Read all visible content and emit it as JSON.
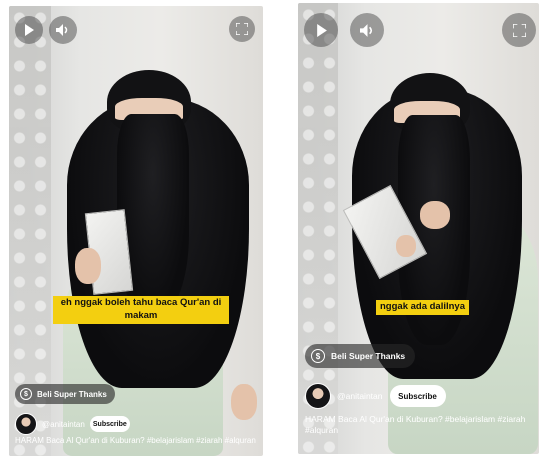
{
  "left_short": {
    "caption": "eh nggak boleh tahu baca Qur'an di makam",
    "thanks_label": "Beli Super Thanks",
    "channel": "@anitaintan",
    "subscribe_label": "Subscribe",
    "title": "HARAM Baca Al Qur'an di Kuburan? #belajarislam #ziarah #alquran"
  },
  "right_short": {
    "caption": "nggak ada dalilnya",
    "thanks_label": "Beli Super Thanks",
    "channel": "@anitaintan",
    "subscribe_label": "Subscribe",
    "title": "HARAM Baca Al Qur'an di Kuburan? #belajarislam #ziarah #alquran"
  },
  "icons": {
    "play": "play-icon",
    "volume": "volume-icon",
    "fullscreen": "fullscreen-icon",
    "super_thanks": "super-thanks-icon"
  },
  "colors": {
    "caption_bg": "#f3cf10",
    "subscribe_bg": "#ffffff",
    "overlay_bg": "#3c3c3c"
  }
}
